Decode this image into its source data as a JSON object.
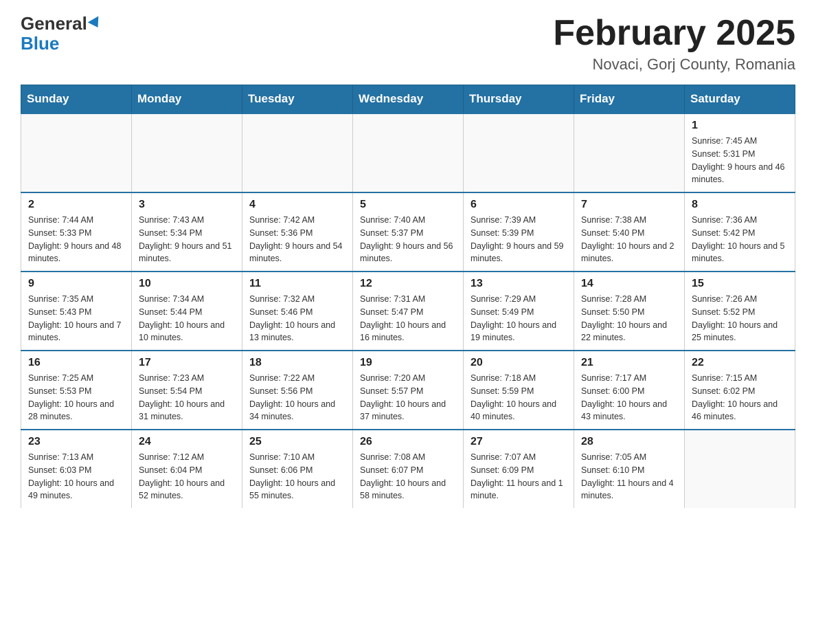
{
  "header": {
    "logo_general": "General",
    "logo_blue": "Blue",
    "title": "February 2025",
    "subtitle": "Novaci, Gorj County, Romania"
  },
  "days_of_week": [
    "Sunday",
    "Monday",
    "Tuesday",
    "Wednesday",
    "Thursday",
    "Friday",
    "Saturday"
  ],
  "weeks": [
    [
      {
        "day": "",
        "info": ""
      },
      {
        "day": "",
        "info": ""
      },
      {
        "day": "",
        "info": ""
      },
      {
        "day": "",
        "info": ""
      },
      {
        "day": "",
        "info": ""
      },
      {
        "day": "",
        "info": ""
      },
      {
        "day": "1",
        "info": "Sunrise: 7:45 AM\nSunset: 5:31 PM\nDaylight: 9 hours and 46 minutes."
      }
    ],
    [
      {
        "day": "2",
        "info": "Sunrise: 7:44 AM\nSunset: 5:33 PM\nDaylight: 9 hours and 48 minutes."
      },
      {
        "day": "3",
        "info": "Sunrise: 7:43 AM\nSunset: 5:34 PM\nDaylight: 9 hours and 51 minutes."
      },
      {
        "day": "4",
        "info": "Sunrise: 7:42 AM\nSunset: 5:36 PM\nDaylight: 9 hours and 54 minutes."
      },
      {
        "day": "5",
        "info": "Sunrise: 7:40 AM\nSunset: 5:37 PM\nDaylight: 9 hours and 56 minutes."
      },
      {
        "day": "6",
        "info": "Sunrise: 7:39 AM\nSunset: 5:39 PM\nDaylight: 9 hours and 59 minutes."
      },
      {
        "day": "7",
        "info": "Sunrise: 7:38 AM\nSunset: 5:40 PM\nDaylight: 10 hours and 2 minutes."
      },
      {
        "day": "8",
        "info": "Sunrise: 7:36 AM\nSunset: 5:42 PM\nDaylight: 10 hours and 5 minutes."
      }
    ],
    [
      {
        "day": "9",
        "info": "Sunrise: 7:35 AM\nSunset: 5:43 PM\nDaylight: 10 hours and 7 minutes."
      },
      {
        "day": "10",
        "info": "Sunrise: 7:34 AM\nSunset: 5:44 PM\nDaylight: 10 hours and 10 minutes."
      },
      {
        "day": "11",
        "info": "Sunrise: 7:32 AM\nSunset: 5:46 PM\nDaylight: 10 hours and 13 minutes."
      },
      {
        "day": "12",
        "info": "Sunrise: 7:31 AM\nSunset: 5:47 PM\nDaylight: 10 hours and 16 minutes."
      },
      {
        "day": "13",
        "info": "Sunrise: 7:29 AM\nSunset: 5:49 PM\nDaylight: 10 hours and 19 minutes."
      },
      {
        "day": "14",
        "info": "Sunrise: 7:28 AM\nSunset: 5:50 PM\nDaylight: 10 hours and 22 minutes."
      },
      {
        "day": "15",
        "info": "Sunrise: 7:26 AM\nSunset: 5:52 PM\nDaylight: 10 hours and 25 minutes."
      }
    ],
    [
      {
        "day": "16",
        "info": "Sunrise: 7:25 AM\nSunset: 5:53 PM\nDaylight: 10 hours and 28 minutes."
      },
      {
        "day": "17",
        "info": "Sunrise: 7:23 AM\nSunset: 5:54 PM\nDaylight: 10 hours and 31 minutes."
      },
      {
        "day": "18",
        "info": "Sunrise: 7:22 AM\nSunset: 5:56 PM\nDaylight: 10 hours and 34 minutes."
      },
      {
        "day": "19",
        "info": "Sunrise: 7:20 AM\nSunset: 5:57 PM\nDaylight: 10 hours and 37 minutes."
      },
      {
        "day": "20",
        "info": "Sunrise: 7:18 AM\nSunset: 5:59 PM\nDaylight: 10 hours and 40 minutes."
      },
      {
        "day": "21",
        "info": "Sunrise: 7:17 AM\nSunset: 6:00 PM\nDaylight: 10 hours and 43 minutes."
      },
      {
        "day": "22",
        "info": "Sunrise: 7:15 AM\nSunset: 6:02 PM\nDaylight: 10 hours and 46 minutes."
      }
    ],
    [
      {
        "day": "23",
        "info": "Sunrise: 7:13 AM\nSunset: 6:03 PM\nDaylight: 10 hours and 49 minutes."
      },
      {
        "day": "24",
        "info": "Sunrise: 7:12 AM\nSunset: 6:04 PM\nDaylight: 10 hours and 52 minutes."
      },
      {
        "day": "25",
        "info": "Sunrise: 7:10 AM\nSunset: 6:06 PM\nDaylight: 10 hours and 55 minutes."
      },
      {
        "day": "26",
        "info": "Sunrise: 7:08 AM\nSunset: 6:07 PM\nDaylight: 10 hours and 58 minutes."
      },
      {
        "day": "27",
        "info": "Sunrise: 7:07 AM\nSunset: 6:09 PM\nDaylight: 11 hours and 1 minute."
      },
      {
        "day": "28",
        "info": "Sunrise: 7:05 AM\nSunset: 6:10 PM\nDaylight: 11 hours and 4 minutes."
      },
      {
        "day": "",
        "info": ""
      }
    ]
  ]
}
